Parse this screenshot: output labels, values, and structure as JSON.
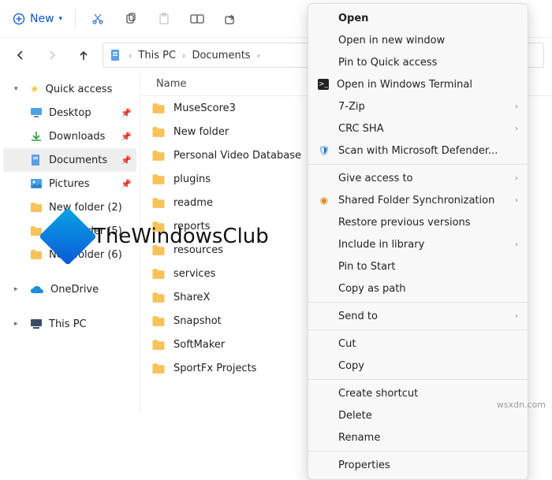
{
  "toolbar": {
    "new_label": "New"
  },
  "breadcrumb": {
    "root": "This PC",
    "folder": "Documents"
  },
  "sidebar": {
    "quick_access": "Quick access",
    "items": [
      {
        "label": "Desktop"
      },
      {
        "label": "Downloads"
      },
      {
        "label": "Documents"
      },
      {
        "label": "Pictures"
      },
      {
        "label": "New folder (2)"
      },
      {
        "label": "New folder (5)"
      },
      {
        "label": "New folder (6)"
      }
    ],
    "onedrive": "OneDrive",
    "thispc": "This PC"
  },
  "column_header": "Name",
  "rows": [
    "MuseScore3",
    "New folder",
    "Personal Video Database",
    "plugins",
    "readme",
    "reports",
    "resources",
    "services",
    "ShareX",
    "Snapshot",
    "SoftMaker",
    "SportFx Projects"
  ],
  "context_menu": {
    "open": "Open",
    "open_new_window": "Open in new window",
    "pin_quick": "Pin to Quick access",
    "open_terminal": "Open in Windows Terminal",
    "sevenzip": "7-Zip",
    "crc_sha": "CRC SHA",
    "defender": "Scan with Microsoft Defender...",
    "give_access": "Give access to",
    "shared_sync": "Shared Folder Synchronization",
    "restore": "Restore previous versions",
    "include_lib": "Include in library",
    "pin_start": "Pin to Start",
    "copy_path": "Copy as path",
    "send_to": "Send to",
    "cut": "Cut",
    "copy": "Copy",
    "create_shortcut": "Create shortcut",
    "delete": "Delete",
    "rename": "Rename",
    "properties": "Properties"
  },
  "watermark": "TheWindowsClub",
  "footer": "wsxdn.com"
}
